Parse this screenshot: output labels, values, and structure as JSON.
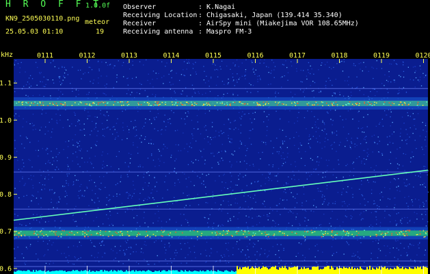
{
  "header": {
    "app_title": "H R O F F T",
    "version": "1.0.0f",
    "filename": "KN9_2505030110.png",
    "meteor_label": "meteor",
    "datetime": "25.05.03 01:10",
    "meteor_count": "19",
    "info": [
      {
        "label": "Observer",
        "value": ": K.Nagai"
      },
      {
        "label": "Receiving Location",
        "value": ": Chigasaki, Japan (139.414 35.340)"
      },
      {
        "label": "Receiver",
        "value": ": AirSpy mini (Miakejima VOR 108.65MHz)"
      },
      {
        "label": "Receiving antenna",
        "value": ": Maspro FM-3"
      }
    ]
  },
  "chart_data": {
    "type": "heatmap",
    "ylabel": "kHz",
    "x_ticks": [
      "0111",
      "0112",
      "0113",
      "0114",
      "0115",
      "0116",
      "0117",
      "0118",
      "0119",
      "0120"
    ],
    "y_ticks": [
      "1.1",
      "1.0",
      "0.9",
      "0.8",
      "0.7",
      "0.6"
    ],
    "ylim": [
      0.585,
      1.165
    ],
    "bands_khz": [
      1.045,
      0.695
    ],
    "faint_lines_khz": [
      1.085,
      0.86,
      0.76,
      0.62,
      0.605
    ],
    "meteor_trail": {
      "start_khz": 0.73,
      "end_khz": 0.865
    },
    "colors": {
      "bg": "#0a1d8f",
      "text": "#ffff55",
      "header_green": "#55ff55",
      "meter_cyan": "#00ffff",
      "meter_yellow": "#ffff00"
    }
  }
}
